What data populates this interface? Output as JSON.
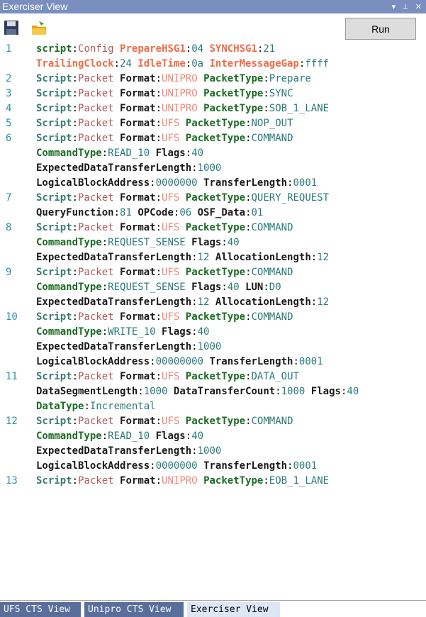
{
  "window": {
    "title": "Exerciser View",
    "dropdown_icon": "chevron-down-icon",
    "pin_icon": "pin-icon",
    "close_icon": "close-icon"
  },
  "toolbar": {
    "save_icon": "save-icon",
    "open_icon": "open-folder-icon",
    "run_label": "Run"
  },
  "colors": {
    "titlebar": "#7a8fbf",
    "line_number": "#2b91af",
    "tab_active": "#dce6f5",
    "tab_inactive": "#5a6e9c"
  },
  "lines": [
    {
      "n": "1",
      "rows": [
        [
          {
            "t": "script",
            "c": "g-key"
          },
          {
            "t": ":",
            "c": "colon"
          },
          {
            "t": "Config ",
            "c": "kw"
          },
          {
            "t": "PrepareHSG1",
            "c": "o-key"
          },
          {
            "t": ":",
            "c": "colon"
          },
          {
            "t": "04 ",
            "c": "val"
          },
          {
            "t": "SYNCHSG1",
            "c": "o-key"
          },
          {
            "t": ":",
            "c": "colon"
          },
          {
            "t": "21",
            "c": "val"
          }
        ],
        [
          {
            "t": "TrailingClock",
            "c": "o-key"
          },
          {
            "t": ":",
            "c": "colon"
          },
          {
            "t": "24 ",
            "c": "val"
          },
          {
            "t": "IdleTime",
            "c": "o-key"
          },
          {
            "t": ":",
            "c": "colon"
          },
          {
            "t": "0a ",
            "c": "val"
          },
          {
            "t": "InterMessageGap",
            "c": "o-key"
          },
          {
            "t": ":",
            "c": "colon"
          },
          {
            "t": "ffff",
            "c": "val"
          }
        ]
      ]
    },
    {
      "n": "2",
      "rows": [
        [
          {
            "t": "Script",
            "c": "b-key"
          },
          {
            "t": ":",
            "c": "colon"
          },
          {
            "t": "Packet ",
            "c": "kw"
          },
          {
            "t": "Format",
            "c": "n-key"
          },
          {
            "t": ":",
            "c": "colon"
          },
          {
            "t": "UNIPRO ",
            "c": "fmt-u"
          },
          {
            "t": "PacketType",
            "c": "g-key"
          },
          {
            "t": ":",
            "c": "colon"
          },
          {
            "t": "Prepare",
            "c": "val"
          }
        ]
      ]
    },
    {
      "n": "3",
      "rows": [
        [
          {
            "t": "Script",
            "c": "b-key"
          },
          {
            "t": ":",
            "c": "colon"
          },
          {
            "t": "Packet ",
            "c": "kw"
          },
          {
            "t": "Format",
            "c": "n-key"
          },
          {
            "t": ":",
            "c": "colon"
          },
          {
            "t": "UNIPRO ",
            "c": "fmt-u"
          },
          {
            "t": "PacketType",
            "c": "g-key"
          },
          {
            "t": ":",
            "c": "colon"
          },
          {
            "t": "SYNC",
            "c": "val"
          }
        ]
      ]
    },
    {
      "n": "4",
      "rows": [
        [
          {
            "t": "Script",
            "c": "b-key"
          },
          {
            "t": ":",
            "c": "colon"
          },
          {
            "t": "Packet ",
            "c": "kw"
          },
          {
            "t": "Format",
            "c": "n-key"
          },
          {
            "t": ":",
            "c": "colon"
          },
          {
            "t": "UNIPRO ",
            "c": "fmt-u"
          },
          {
            "t": "PacketType",
            "c": "g-key"
          },
          {
            "t": ":",
            "c": "colon"
          },
          {
            "t": "SOB_1_LANE",
            "c": "val"
          }
        ]
      ]
    },
    {
      "n": "5",
      "rows": [
        [
          {
            "t": "Script",
            "c": "b-key"
          },
          {
            "t": ":",
            "c": "colon"
          },
          {
            "t": "Packet ",
            "c": "kw"
          },
          {
            "t": "Format",
            "c": "n-key"
          },
          {
            "t": ":",
            "c": "colon"
          },
          {
            "t": "UFS ",
            "c": "fmt-u"
          },
          {
            "t": "PacketType",
            "c": "g-key"
          },
          {
            "t": ":",
            "c": "colon"
          },
          {
            "t": "NOP_OUT",
            "c": "val"
          }
        ]
      ]
    },
    {
      "n": "6",
      "rows": [
        [
          {
            "t": "Script",
            "c": "b-key"
          },
          {
            "t": ":",
            "c": "colon"
          },
          {
            "t": "Packet ",
            "c": "kw"
          },
          {
            "t": "Format",
            "c": "n-key"
          },
          {
            "t": ":",
            "c": "colon"
          },
          {
            "t": "UFS ",
            "c": "fmt-u"
          },
          {
            "t": "PacketType",
            "c": "g-key"
          },
          {
            "t": ":",
            "c": "colon"
          },
          {
            "t": "COMMAND",
            "c": "val"
          }
        ],
        [
          {
            "t": "CommandType",
            "c": "g-key"
          },
          {
            "t": ":",
            "c": "colon"
          },
          {
            "t": "READ_10 ",
            "c": "val"
          },
          {
            "t": "Flags",
            "c": "n-key"
          },
          {
            "t": ":",
            "c": "colon"
          },
          {
            "t": "40",
            "c": "val"
          }
        ],
        [
          {
            "t": "ExpectedDataTransferLength",
            "c": "n-key"
          },
          {
            "t": ":",
            "c": "colon"
          },
          {
            "t": "1000",
            "c": "val"
          }
        ],
        [
          {
            "t": "LogicalBlockAddress",
            "c": "n-key"
          },
          {
            "t": ":",
            "c": "colon"
          },
          {
            "t": "0000000 ",
            "c": "val"
          },
          {
            "t": "TransferLength",
            "c": "n-key"
          },
          {
            "t": ":",
            "c": "colon"
          },
          {
            "t": "0001",
            "c": "val"
          }
        ]
      ]
    },
    {
      "n": "7",
      "rows": [
        [
          {
            "t": "Script",
            "c": "b-key"
          },
          {
            "t": ":",
            "c": "colon"
          },
          {
            "t": "Packet ",
            "c": "kw"
          },
          {
            "t": "Format",
            "c": "n-key"
          },
          {
            "t": ":",
            "c": "colon"
          },
          {
            "t": "UFS ",
            "c": "fmt-u"
          },
          {
            "t": "PacketType",
            "c": "g-key"
          },
          {
            "t": ":",
            "c": "colon"
          },
          {
            "t": "QUERY_REQUEST",
            "c": "val"
          }
        ],
        [
          {
            "t": "QueryFunction",
            "c": "n-key"
          },
          {
            "t": ":",
            "c": "colon"
          },
          {
            "t": "81 ",
            "c": "val"
          },
          {
            "t": "OPCode",
            "c": "n-key"
          },
          {
            "t": ":",
            "c": "colon"
          },
          {
            "t": "06 ",
            "c": "val"
          },
          {
            "t": "OSF_Data",
            "c": "n-key"
          },
          {
            "t": ":",
            "c": "colon"
          },
          {
            "t": "01",
            "c": "val"
          }
        ]
      ]
    },
    {
      "n": "8",
      "rows": [
        [
          {
            "t": "Script",
            "c": "b-key"
          },
          {
            "t": ":",
            "c": "colon"
          },
          {
            "t": "Packet ",
            "c": "kw"
          },
          {
            "t": "Format",
            "c": "n-key"
          },
          {
            "t": ":",
            "c": "colon"
          },
          {
            "t": "UFS ",
            "c": "fmt-u"
          },
          {
            "t": "PacketType",
            "c": "g-key"
          },
          {
            "t": ":",
            "c": "colon"
          },
          {
            "t": "COMMAND",
            "c": "val"
          }
        ],
        [
          {
            "t": "CommandType",
            "c": "g-key"
          },
          {
            "t": ":",
            "c": "colon"
          },
          {
            "t": "REQUEST_SENSE ",
            "c": "val"
          },
          {
            "t": "Flags",
            "c": "n-key"
          },
          {
            "t": ":",
            "c": "colon"
          },
          {
            "t": "40",
            "c": "val"
          }
        ],
        [
          {
            "t": "ExpectedDataTransferLength",
            "c": "n-key"
          },
          {
            "t": ":",
            "c": "colon"
          },
          {
            "t": "12 ",
            "c": "val"
          },
          {
            "t": "AllocationLength",
            "c": "n-key"
          },
          {
            "t": ":",
            "c": "colon"
          },
          {
            "t": "12",
            "c": "val"
          }
        ]
      ]
    },
    {
      "n": "9",
      "rows": [
        [
          {
            "t": "Script",
            "c": "b-key"
          },
          {
            "t": ":",
            "c": "colon"
          },
          {
            "t": "Packet ",
            "c": "kw"
          },
          {
            "t": "Format",
            "c": "n-key"
          },
          {
            "t": ":",
            "c": "colon"
          },
          {
            "t": "UFS ",
            "c": "fmt-u"
          },
          {
            "t": "PacketType",
            "c": "g-key"
          },
          {
            "t": ":",
            "c": "colon"
          },
          {
            "t": "COMMAND",
            "c": "val"
          }
        ],
        [
          {
            "t": "CommandType",
            "c": "g-key"
          },
          {
            "t": ":",
            "c": "colon"
          },
          {
            "t": "REQUEST_SENSE ",
            "c": "val"
          },
          {
            "t": "Flags",
            "c": "n-key"
          },
          {
            "t": ":",
            "c": "colon"
          },
          {
            "t": "40 ",
            "c": "val"
          },
          {
            "t": "LUN",
            "c": "n-key"
          },
          {
            "t": ":",
            "c": "colon"
          },
          {
            "t": "D0",
            "c": "val"
          }
        ],
        [
          {
            "t": "ExpectedDataTransferLength",
            "c": "n-key"
          },
          {
            "t": ":",
            "c": "colon"
          },
          {
            "t": "12 ",
            "c": "val"
          },
          {
            "t": "AllocationLength",
            "c": "n-key"
          },
          {
            "t": ":",
            "c": "colon"
          },
          {
            "t": "12",
            "c": "val"
          }
        ]
      ]
    },
    {
      "n": "10",
      "rows": [
        [
          {
            "t": "Script",
            "c": "b-key"
          },
          {
            "t": ":",
            "c": "colon"
          },
          {
            "t": "Packet ",
            "c": "kw"
          },
          {
            "t": "Format",
            "c": "n-key"
          },
          {
            "t": ":",
            "c": "colon"
          },
          {
            "t": "UFS ",
            "c": "fmt-u"
          },
          {
            "t": "PacketType",
            "c": "g-key"
          },
          {
            "t": ":",
            "c": "colon"
          },
          {
            "t": "COMMAND",
            "c": "val"
          }
        ],
        [
          {
            "t": "CommandType",
            "c": "g-key"
          },
          {
            "t": ":",
            "c": "colon"
          },
          {
            "t": "WRITE_10 ",
            "c": "val"
          },
          {
            "t": "Flags",
            "c": "n-key"
          },
          {
            "t": ":",
            "c": "colon"
          },
          {
            "t": "40",
            "c": "val"
          }
        ],
        [
          {
            "t": "ExpectedDataTransferLength",
            "c": "n-key"
          },
          {
            "t": ":",
            "c": "colon"
          },
          {
            "t": "1000",
            "c": "val"
          }
        ],
        [
          {
            "t": "LogicalBlockAddress",
            "c": "n-key"
          },
          {
            "t": ":",
            "c": "colon"
          },
          {
            "t": "00000000 ",
            "c": "val"
          },
          {
            "t": "TransferLength",
            "c": "n-key"
          },
          {
            "t": ":",
            "c": "colon"
          },
          {
            "t": "0001",
            "c": "val"
          }
        ]
      ]
    },
    {
      "n": "11",
      "rows": [
        [
          {
            "t": "Script",
            "c": "b-key"
          },
          {
            "t": ":",
            "c": "colon"
          },
          {
            "t": "Packet ",
            "c": "kw"
          },
          {
            "t": "Format",
            "c": "n-key"
          },
          {
            "t": ":",
            "c": "colon"
          },
          {
            "t": "UFS ",
            "c": "fmt-u"
          },
          {
            "t": "PacketType",
            "c": "g-key"
          },
          {
            "t": ":",
            "c": "colon"
          },
          {
            "t": "DATA_OUT",
            "c": "val"
          }
        ],
        [
          {
            "t": "DataSegmentLength",
            "c": "n-key"
          },
          {
            "t": ":",
            "c": "colon"
          },
          {
            "t": "1000 ",
            "c": "val"
          },
          {
            "t": "DataTransferCount",
            "c": "n-key"
          },
          {
            "t": ":",
            "c": "colon"
          },
          {
            "t": "1000 ",
            "c": "val"
          },
          {
            "t": "Flags",
            "c": "n-key"
          },
          {
            "t": ":",
            "c": "colon"
          },
          {
            "t": "40",
            "c": "val"
          }
        ],
        [
          {
            "t": "DataType",
            "c": "g-key"
          },
          {
            "t": ":",
            "c": "colon"
          },
          {
            "t": "Incremental",
            "c": "val"
          }
        ]
      ]
    },
    {
      "n": "12",
      "rows": [
        [
          {
            "t": "Script",
            "c": "b-key"
          },
          {
            "t": ":",
            "c": "colon"
          },
          {
            "t": "Packet ",
            "c": "kw"
          },
          {
            "t": "Format",
            "c": "n-key"
          },
          {
            "t": ":",
            "c": "colon"
          },
          {
            "t": "UFS ",
            "c": "fmt-u"
          },
          {
            "t": "PacketType",
            "c": "g-key"
          },
          {
            "t": ":",
            "c": "colon"
          },
          {
            "t": "COMMAND",
            "c": "val"
          }
        ],
        [
          {
            "t": "CommandType",
            "c": "g-key"
          },
          {
            "t": ":",
            "c": "colon"
          },
          {
            "t": "READ_10 ",
            "c": "val"
          },
          {
            "t": "Flags",
            "c": "n-key"
          },
          {
            "t": ":",
            "c": "colon"
          },
          {
            "t": "40",
            "c": "val"
          }
        ],
        [
          {
            "t": "ExpectedDataTransferLength",
            "c": "n-key"
          },
          {
            "t": ":",
            "c": "colon"
          },
          {
            "t": "1000",
            "c": "val"
          }
        ],
        [
          {
            "t": "LogicalBlockAddress",
            "c": "n-key"
          },
          {
            "t": ":",
            "c": "colon"
          },
          {
            "t": "0000000 ",
            "c": "val"
          },
          {
            "t": "TransferLength",
            "c": "n-key"
          },
          {
            "t": ":",
            "c": "colon"
          },
          {
            "t": "0001",
            "c": "val"
          }
        ]
      ]
    },
    {
      "n": "13",
      "rows": [
        [
          {
            "t": "Script",
            "c": "b-key"
          },
          {
            "t": ":",
            "c": "colon"
          },
          {
            "t": "Packet ",
            "c": "kw"
          },
          {
            "t": "Format",
            "c": "n-key"
          },
          {
            "t": ":",
            "c": "colon"
          },
          {
            "t": "UNIPRO ",
            "c": "fmt-u"
          },
          {
            "t": "PacketType",
            "c": "g-key"
          },
          {
            "t": ":",
            "c": "colon"
          },
          {
            "t": "EOB_1_LANE",
            "c": "val"
          }
        ]
      ]
    }
  ],
  "tabs": [
    {
      "label": "UFS CTS View",
      "active": false
    },
    {
      "label": "Unipro CTS View",
      "active": false
    },
    {
      "label": "Exerciser View",
      "active": true
    }
  ]
}
